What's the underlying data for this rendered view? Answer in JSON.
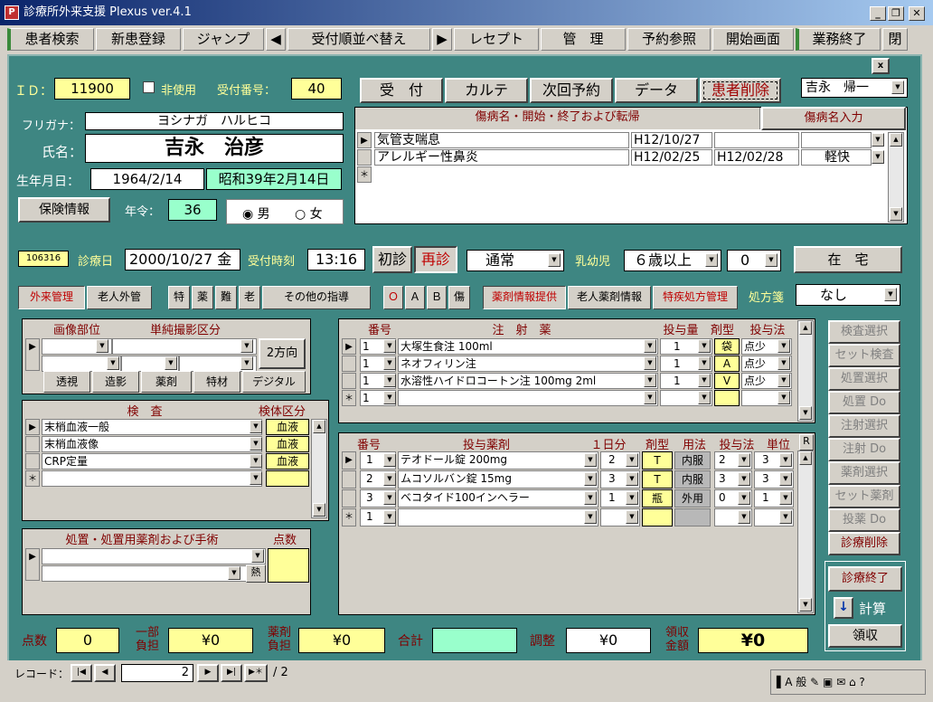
{
  "window": {
    "title": "診療所外来支援 Plexus ver.4.1",
    "app_icon": "plexus-icon"
  },
  "menu": [
    "患者検索",
    "新患登録",
    "ジャンプ",
    "◀",
    "受付順並べ替え",
    "▶",
    "レセプト",
    "管　理",
    "予約参照",
    "開始画面",
    "業務終了",
    "閉"
  ],
  "patient": {
    "id_label": "ＩＤ：",
    "id": "11900",
    "unused_label": "非使用",
    "reception_label": "受付番号：",
    "reception_no": "40",
    "kana_label": "フリガナ：",
    "kana": "ヨシナガ　ハルヒコ",
    "name_label": "氏名：",
    "name": "吉永　治彦",
    "dob_label": "生年月日：",
    "dob": "1964/2/14",
    "dob_jp": "昭和39年2月14日",
    "insurance_btn": "保険情報",
    "age_label": "年令：",
    "age": "36",
    "male": "男",
    "female": "女"
  },
  "actions": [
    "受　付",
    "カルテ",
    "次回予約",
    "データ",
    "患者削除"
  ],
  "doctor": "吉永　帰一",
  "disease": {
    "header": "傷病名・開始・終了および転帰",
    "input_btn": "傷病名入力",
    "rows": [
      {
        "name": "気管支喘息",
        "start": "H12/10/27",
        "end": "",
        "outcome": ""
      },
      {
        "name": "アレルギー性鼻炎",
        "start": "H12/02/25",
        "end": "H12/02/28",
        "outcome": "軽快"
      }
    ]
  },
  "visit": {
    "code": "106316",
    "date_label": "診療日",
    "date": "2000/10/27 金",
    "time_label": "受付時刻",
    "time": "13:16",
    "first": "初診",
    "revisit": "再診",
    "type": "通常",
    "infant_label": "乳幼児",
    "infant": "６歳以上",
    "infant_num": "0",
    "home": "在　宅"
  },
  "tabs": [
    "外来管理",
    "老人外管"
  ],
  "specials": [
    "特",
    "薬",
    "難",
    "老",
    "その他の指導"
  ],
  "oab": [
    "Ｏ",
    "Ａ",
    "Ｂ",
    "傷"
  ],
  "drug_info": [
    "薬剤情報提供",
    "老人薬剤情報",
    "特疾処方管理"
  ],
  "prescription": {
    "label": "処方箋",
    "value": "なし"
  },
  "imaging": {
    "header1": "画像部位",
    "header2": "単純撮影区分",
    "direction": "2方向",
    "buttons": [
      "透視",
      "造影",
      "薬剤",
      "特材",
      "デジタル"
    ]
  },
  "tests": {
    "header1": "検　査",
    "header2": "検体区分",
    "rows": [
      {
        "name": "末梢血液一般",
        "kind": "血液"
      },
      {
        "name": "末梢血液像",
        "kind": "血液"
      },
      {
        "name": "CRP定量",
        "kind": "血液"
      }
    ]
  },
  "procedure": {
    "header1": "処置・処置用薬剤および手術",
    "header2": "点数",
    "heat": "熱"
  },
  "injection": {
    "headers": [
      "番号",
      "注　射　薬",
      "投与量",
      "剤型",
      "投与法"
    ],
    "rows": [
      {
        "no": "1",
        "name": "大塚生食注 100ml",
        "qty": "1",
        "form": "袋",
        "method": "点少"
      },
      {
        "no": "1",
        "name": "ネオフィリン注",
        "qty": "1",
        "form": "A",
        "method": "点少"
      },
      {
        "no": "1",
        "name": "水溶性ハイドロコートン注 100mg 2ml",
        "qty": "1",
        "form": "V",
        "method": "点少"
      },
      {
        "no": "1",
        "name": "",
        "qty": "",
        "form": "",
        "method": ""
      }
    ]
  },
  "medicine": {
    "headers": [
      "番号",
      "投与薬剤",
      "１日分",
      "剤型",
      "用法",
      "投与法",
      "単位",
      "R"
    ],
    "rows": [
      {
        "no": "1",
        "name": "テオドール錠 200mg",
        "daily": "2",
        "form": "T",
        "usage": "内服",
        "m1": "2",
        "m2": "3"
      },
      {
        "no": "2",
        "name": "ムコソルバン錠 15mg",
        "daily": "3",
        "form": "T",
        "usage": "内服",
        "m1": "3",
        "m2": "3"
      },
      {
        "no": "3",
        "name": "ベコタイド100インヘラー",
        "daily": "1",
        "form": "瓶",
        "usage": "外用",
        "m1": "0",
        "m2": "1"
      },
      {
        "no": "1",
        "name": "",
        "daily": "",
        "form": "",
        "usage": "",
        "m1": "",
        "m2": ""
      }
    ]
  },
  "side_buttons": [
    "検査選択",
    "セット検査",
    "処置選択",
    "処置 Do",
    "注射選択",
    "注射 Do",
    "薬剤選択",
    "セット薬剤",
    "投薬 Do",
    "診療削除"
  ],
  "end_btn": "診療終了",
  "calc_btn": "計算",
  "receipt_btn": "領収",
  "totals": {
    "points_label": "点数",
    "points": "0",
    "partial_label": "一部負担",
    "partial": "¥0",
    "drug_label": "薬剤負担",
    "drug": "¥0",
    "sum_label": "合計",
    "sum": "",
    "adjust_label": "調整",
    "adjust": "¥0",
    "receive_label": "領収金額",
    "receive": "¥0"
  },
  "record": {
    "label": "レコード：",
    "current": "2",
    "total": "/ 2"
  },
  "tray": "般"
}
